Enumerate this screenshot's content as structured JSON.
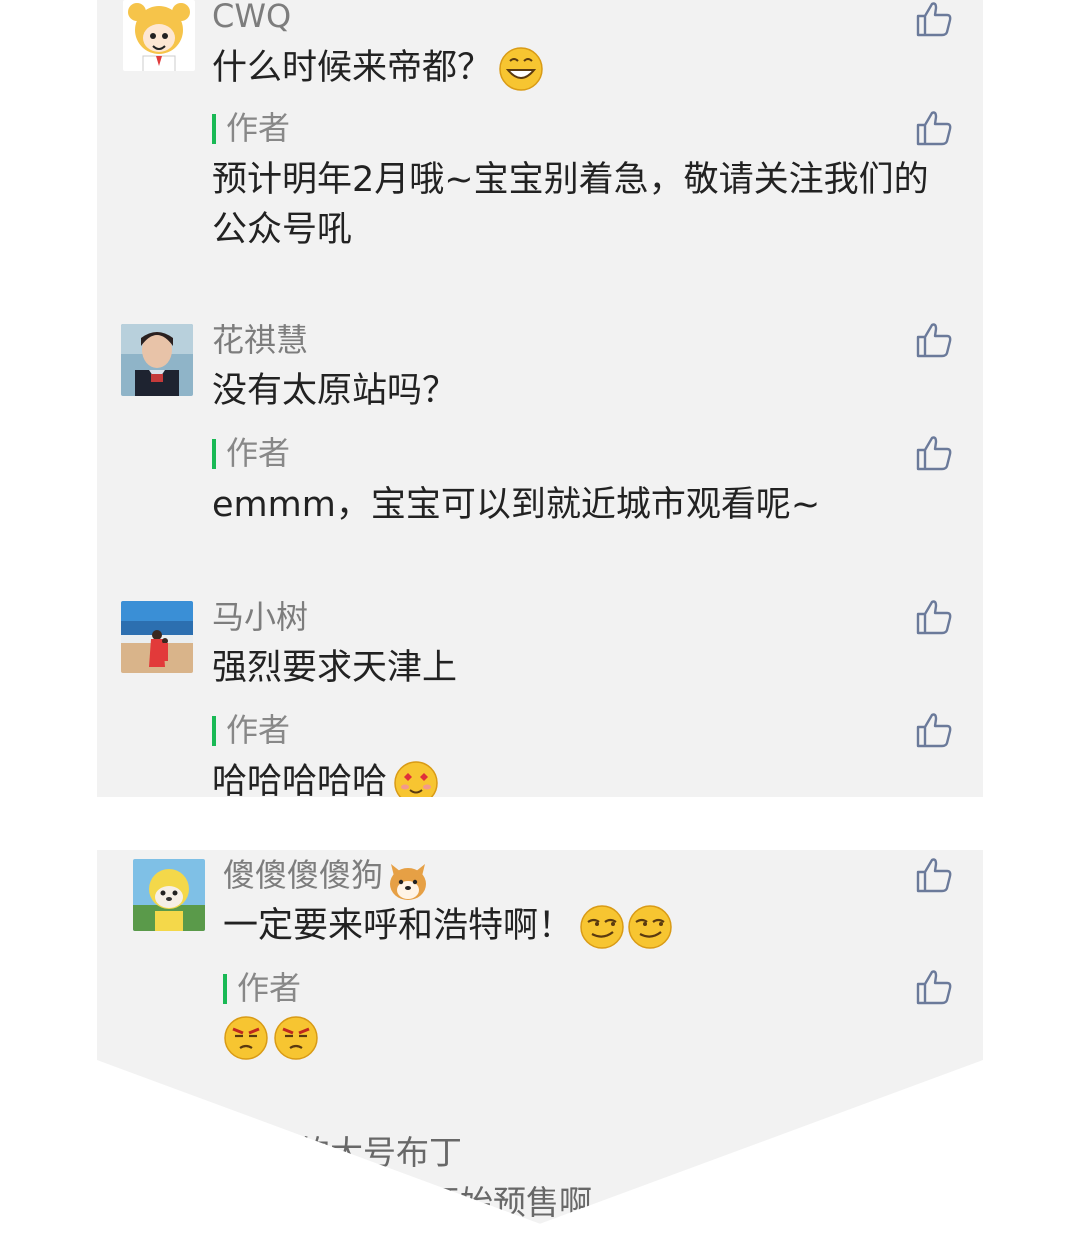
{
  "comments": [
    {
      "nickname": "CWQ",
      "text": "什么时候来帝都？",
      "emoji": "grin-emoji",
      "reply_label": "作者",
      "reply_text": "预计明年2月哦~宝宝别着急，敬请关注我们的公众号吼"
    },
    {
      "nickname": "花祺慧",
      "text": "没有太原站吗？",
      "reply_label": "作者",
      "reply_text": "emmm，宝宝可以到就近城市观看呢~"
    },
    {
      "nickname": "马小树",
      "text": "强烈要求天津上",
      "reply_label": "作者",
      "reply_text": "哈哈哈哈哈",
      "reply_emoji": "heart-eyes-emoji"
    },
    {
      "nickname": "傻傻傻傻狗",
      "nickname_emoji": "shiba-dog-emoji",
      "text": "一定要来呼和浩特啊！",
      "emoji": "smug-emoji",
      "reply_label": "作者",
      "reply_emoji": "annoyed-emoji"
    },
    {
      "nickname": "的大号布丁",
      "text": "开始预售啊"
    }
  ],
  "colors": {
    "panel_bg": "#f2f2f2",
    "accent_green": "#19b955",
    "like_icon": "#6b7a9a"
  }
}
